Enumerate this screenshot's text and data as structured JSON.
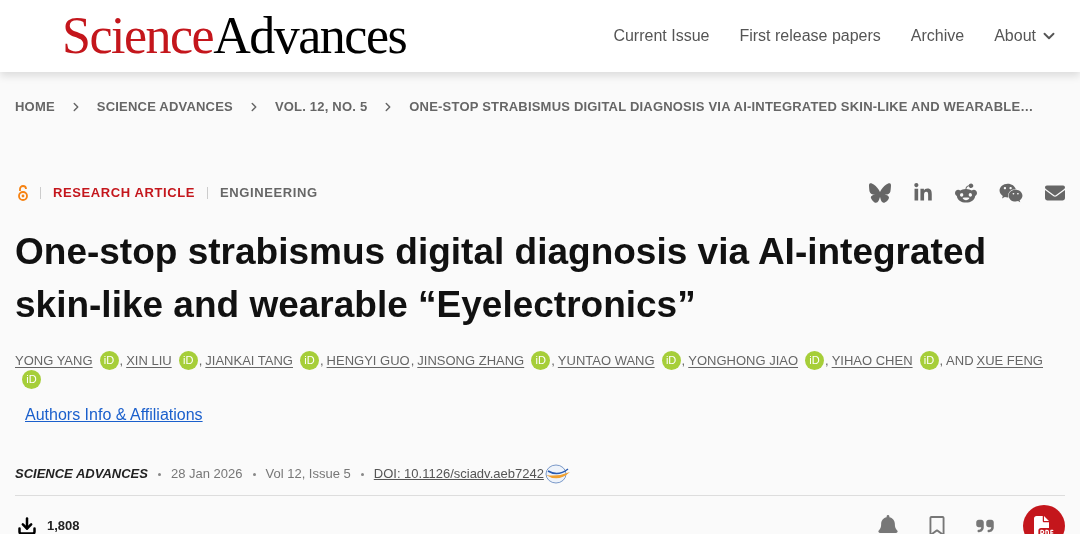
{
  "header": {
    "logo": {
      "part1": "Science",
      "part2": "Advances"
    },
    "nav": [
      {
        "label": "Current Issue",
        "kind": "link"
      },
      {
        "label": "First release papers",
        "kind": "link"
      },
      {
        "label": "Archive",
        "kind": "link"
      },
      {
        "label": "About",
        "kind": "dropdown"
      }
    ]
  },
  "breadcrumb": [
    "HOME",
    "SCIENCE ADVANCES",
    "VOL. 12, NO. 5",
    "ONE-STOP STRABISMUS DIGITAL DIAGNOSIS VIA AI-INTEGRATED SKIN-LIKE AND WEARABLE…"
  ],
  "article": {
    "type": "RESEARCH ARTICLE",
    "subject": "ENGINEERING",
    "title": "One-stop strabismus digital diagnosis via AI-integrated skin-like and wearable “Eyelectronics”",
    "authors": [
      {
        "name": "YONG YANG",
        "orcid": "iD",
        "suffix": ","
      },
      {
        "name": "XIN LIU",
        "orcid": "iD",
        "suffix": ","
      },
      {
        "name": "JIANKAI TANG",
        "orcid": "iD",
        "suffix": ","
      },
      {
        "name": "HENGYI GUO",
        "suffix": ","
      },
      {
        "name": "JINSONG ZHANG",
        "orcid": "iD",
        "suffix": ","
      },
      {
        "name": "YUNTAO WANG",
        "orcid": "iD",
        "suffix": ","
      },
      {
        "name": "YONGHONG JIAO",
        "orcid": "iD",
        "suffix": ","
      },
      {
        "name": "YIHAO CHEN",
        "orcid": "iD",
        "suffix": ", AND"
      },
      {
        "name": "XUE FENG",
        "orcid": "iD"
      }
    ],
    "affiliations_link": "Authors Info & Affiliations",
    "journal": "SCIENCE ADVANCES",
    "date": "28 Jan 2026",
    "issue": "Vol 12, Issue 5",
    "doi": "DOI: 10.1126/sciadv.aeb7242",
    "downloads": "1,808"
  }
}
